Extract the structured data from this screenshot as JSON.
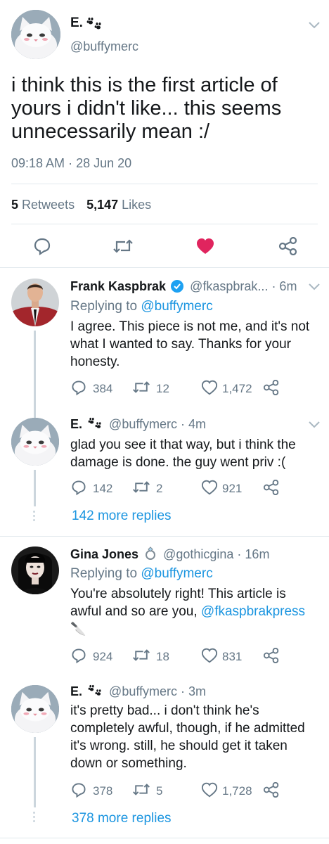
{
  "main_tweet": {
    "display_name": "E.",
    "handle": "@buffymerc",
    "text_lines": [
      "i think this is the first article of",
      "yours i didn't like... this seems",
      "unnecessarily mean :/"
    ],
    "time": "09:18 AM",
    "dot": "·",
    "date": "28 Jun 20",
    "retweets_count": "5",
    "retweets_label": "Retweets",
    "likes_count": "5,147",
    "likes_label": "Likes"
  },
  "replies": [
    {
      "name": "Frank Kaspbrak",
      "handle": "@fkaspbrak...",
      "time": "· 6m",
      "replying_prefix": "Replying to",
      "replying_to": "@buffymerc",
      "lines": [
        "I agree. This piece is not me, and it's not",
        "what I wanted to say. Thanks for your",
        "honesty."
      ],
      "replies": "384",
      "retweets": "12",
      "likes": "1,472"
    },
    {
      "name": "E.",
      "handle": "@buffymerc",
      "time": "· 4m",
      "lines": [
        "glad you see it that way, but i think the",
        "damage is done. the guy went priv :("
      ],
      "replies": "142",
      "retweets": "2",
      "likes": "921",
      "more": "142 more replies"
    },
    {
      "name": "Gina Jones",
      "handle": "@gothicgina",
      "time": "· 16m",
      "replying_prefix": "Replying to",
      "replying_to": "@buffymerc",
      "lines": [
        "You're absolutely right! This article is"
      ],
      "line2_text": "awful and so are you,",
      "line2_mention": "@fkaspbrakpress",
      "line3_emoji": "🔪",
      "replies": "924",
      "retweets": "18",
      "likes": "831"
    },
    {
      "name": "E.",
      "handle": "@buffymerc",
      "time": "· 3m",
      "lines": [
        "it's pretty bad... i don't think he's",
        "completely awful, though, if he admitted",
        "it's wrong. still, he should get it taken",
        "down or something."
      ],
      "replies": "378",
      "retweets": "5",
      "likes": "1,728",
      "more": "378 more replies"
    }
  ],
  "icons": {
    "verified": "verified-badge-icon",
    "paw": "paw-prints-icon",
    "ring": "ring-icon",
    "knife": "knife-icon"
  },
  "colors": {
    "link": "#1b95e0",
    "like": "#e0245e",
    "muted": "#657786",
    "verified": "#1da1f2"
  }
}
